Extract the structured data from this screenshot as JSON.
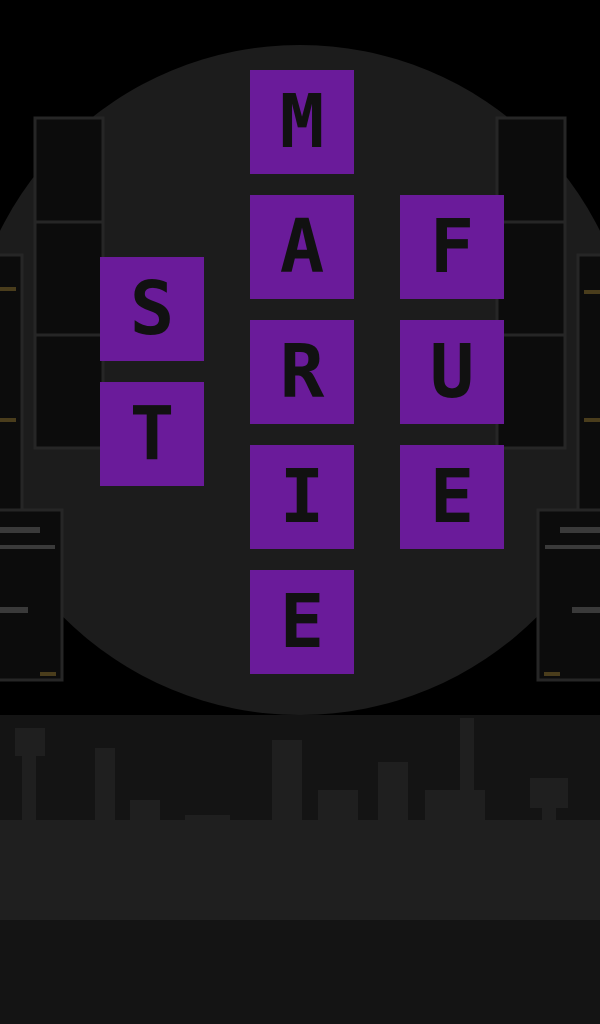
{
  "columns": [
    {
      "tiles": [
        "S",
        "T"
      ]
    },
    {
      "tiles": [
        "M",
        "A",
        "R",
        "I",
        "E"
      ]
    },
    {
      "tiles": [
        "F",
        "U",
        "E"
      ]
    }
  ],
  "colors": {
    "background": "#000000",
    "moon": "#1c1c1c",
    "tile": "#6a1b9a",
    "letter": "#111111",
    "crowd": "#1f1f1f"
  }
}
